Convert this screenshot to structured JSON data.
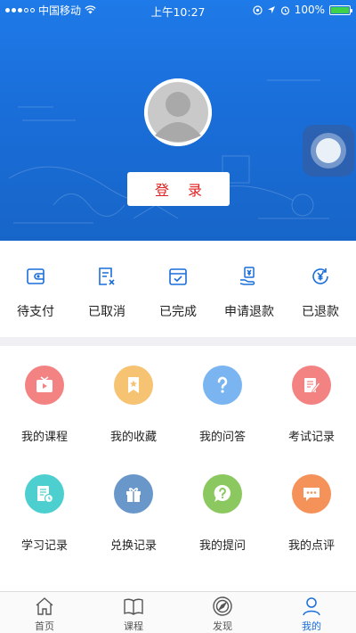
{
  "status_bar": {
    "carrier": "中国移动",
    "time": "上午10:27",
    "battery_text": "100%",
    "battery_level": 1.0
  },
  "profile": {
    "login_label": "登 录"
  },
  "orders": [
    {
      "label": "待支付",
      "icon": "wallet-icon"
    },
    {
      "label": "已取消",
      "icon": "cancel-doc-icon"
    },
    {
      "label": "已完成",
      "icon": "calendar-check-icon"
    },
    {
      "label": "申请退款",
      "icon": "refund-hand-icon"
    },
    {
      "label": "已退款",
      "icon": "yen-refresh-icon"
    }
  ],
  "menu": [
    {
      "label": "我的课程",
      "icon": "video-play-icon",
      "color": "#f38383"
    },
    {
      "label": "我的收藏",
      "icon": "bookmark-star-icon",
      "color": "#f6c373"
    },
    {
      "label": "我的问答",
      "icon": "question-icon",
      "color": "#7ab5f2"
    },
    {
      "label": "考试记录",
      "icon": "exam-edit-icon",
      "color": "#f38383"
    },
    {
      "label": "学习记录",
      "icon": "study-clock-icon",
      "color": "#4dcfd0"
    },
    {
      "label": "兑换记录",
      "icon": "gift-icon",
      "color": "#6a97c9"
    },
    {
      "label": "我的提问",
      "icon": "question-bubble-icon",
      "color": "#8cc860"
    },
    {
      "label": "我的点评",
      "icon": "comment-icon",
      "color": "#f5925a"
    }
  ],
  "tabs": [
    {
      "label": "首页",
      "icon": "home-icon",
      "active": false
    },
    {
      "label": "课程",
      "icon": "book-icon",
      "active": false
    },
    {
      "label": "发现",
      "icon": "compass-icon",
      "active": false
    },
    {
      "label": "我的",
      "icon": "user-icon",
      "active": true
    }
  ],
  "colors": {
    "accent": "#1a6ed9",
    "login_text": "#e02020",
    "order_icon": "#1a6ed9",
    "band": "#efeff4"
  }
}
